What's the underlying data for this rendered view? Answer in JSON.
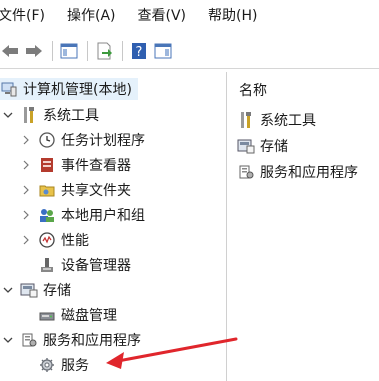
{
  "menubar": {
    "items": [
      "文件(F)",
      "操作(A)",
      "查看(V)",
      "帮助(H)"
    ]
  },
  "tree": {
    "root": "计算机管理(本地)",
    "system_tools": "系统工具",
    "task_scheduler": "任务计划程序",
    "event_viewer": "事件查看器",
    "shared_folders": "共享文件夹",
    "local_users": "本地用户和组",
    "performance": "性能",
    "device_manager": "设备管理器",
    "storage": "存储",
    "disk_management": "磁盘管理",
    "services_apps": "服务和应用程序",
    "services": "服务"
  },
  "list": {
    "header": "名称",
    "items": [
      "系统工具",
      "存储",
      "服务和应用程序"
    ]
  },
  "colors": {
    "selection": "#e5f1fb",
    "annotation_arrow": "#e0262c"
  }
}
